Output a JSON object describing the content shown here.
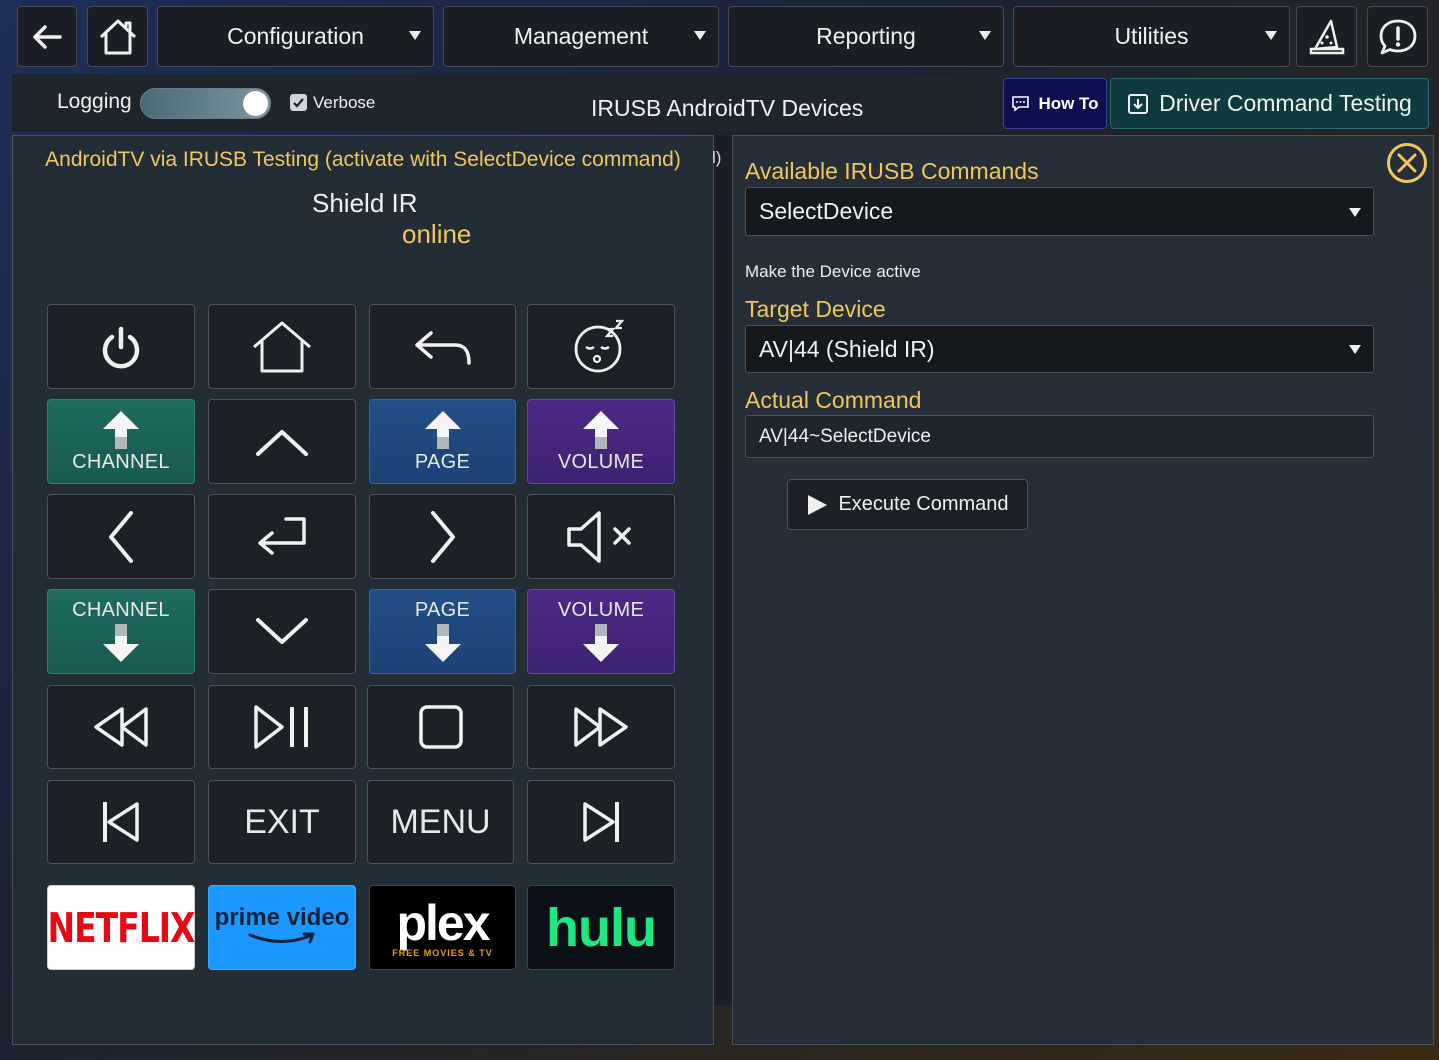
{
  "nav": {
    "back_icon": "arrow-left-icon",
    "home_icon": "home-icon",
    "menus": [
      {
        "label": "Configuration"
      },
      {
        "label": "Management"
      },
      {
        "label": "Reporting"
      },
      {
        "label": "Utilities"
      }
    ],
    "wizard_icon": "wizard-hat-icon",
    "alert_icon": "exclamation-chat-icon"
  },
  "subheader": {
    "logging_label": "Logging",
    "logging_on": true,
    "verbose_label": "Verbose",
    "verbose_checked": true,
    "title": "IRUSB AndroidTV Devices",
    "howto_label": "How To",
    "driver_testing_label": "Driver Command Testing"
  },
  "remote": {
    "heading": "AndroidTV via IRUSB Testing (activate with SelectDevice command)",
    "device_name": "Shield IR",
    "status": "online",
    "labels": {
      "channel_up": "CHANNEL",
      "page_up": "PAGE",
      "volume_up": "VOLUME",
      "channel_down": "CHANNEL",
      "page_down": "PAGE",
      "volume_down": "VOLUME",
      "exit": "EXIT",
      "menu": "MENU"
    },
    "apps": {
      "netflix": "NETFLIX",
      "prime_line1": "prime video",
      "plex": "plex",
      "plex_sub": "FREE MOVIES & TV",
      "hulu": "hulu"
    }
  },
  "commands": {
    "available_label": "Available IRUSB Commands",
    "selected_command": "SelectDevice",
    "description": "Make the Device active",
    "target_label": "Target Device",
    "target_value": "AV|44 (Shield IR)",
    "actual_label": "Actual Command",
    "actual_value": "AV|44~SelectDevice",
    "execute_label": "Execute Command"
  },
  "hidden_fragment": "l)",
  "colors": {
    "accent_yellow": "#f2c65d",
    "teal": "#1f6b62",
    "blue": "#234e86",
    "purple": "#4d2a86"
  }
}
